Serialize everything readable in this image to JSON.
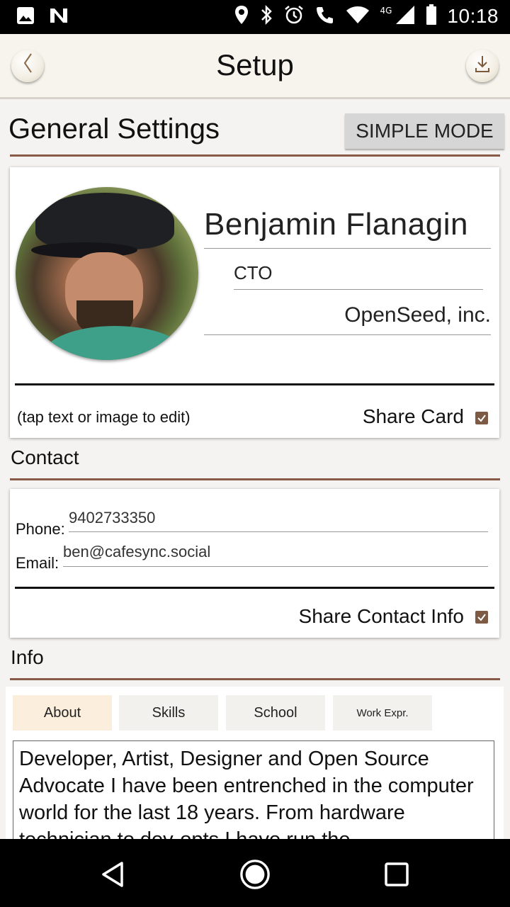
{
  "status_bar": {
    "time": "10:18",
    "network": "4G",
    "left_icons": [
      "gallery-icon",
      "n-icon"
    ],
    "right_icons": [
      "location-icon",
      "bluetooth-icon",
      "alarm-icon",
      "call-icon",
      "wifi-icon",
      "signal-icon",
      "battery-icon"
    ]
  },
  "app_bar": {
    "title": "Setup",
    "back_icon": "chevron-left-icon",
    "download_icon": "download-icon"
  },
  "general": {
    "title": "General Settings",
    "simple_mode_label": "SIMPLE MODE"
  },
  "card": {
    "name": "Benjamin Flanagin",
    "job_title": "CTO",
    "company": "OpenSeed, inc.",
    "hint": "(tap text or image to edit)",
    "share_label": "Share Card",
    "share_checked": true
  },
  "contact": {
    "section_label": "Contact",
    "phone_label": "Phone:",
    "phone_value": "9402733350",
    "email_label": "Email:",
    "email_value": "ben@cafesync.social",
    "share_label": "Share Contact Info",
    "share_checked": true
  },
  "info": {
    "section_label": "Info",
    "tabs": [
      {
        "label": "About",
        "active": true
      },
      {
        "label": "Skills",
        "active": false
      },
      {
        "label": "School",
        "active": false
      },
      {
        "label": "Work Expr.",
        "active": false
      }
    ],
    "about_text": "Developer, Artist, Designer and Open Source Advocate I have been entrenched in the computer world for the last 18 years. From hardware technician to dev-opts I have run the"
  },
  "colors": {
    "accent": "#8a5a48",
    "checkbox": "#7d5a43",
    "active_tab": "#fbeedd"
  }
}
